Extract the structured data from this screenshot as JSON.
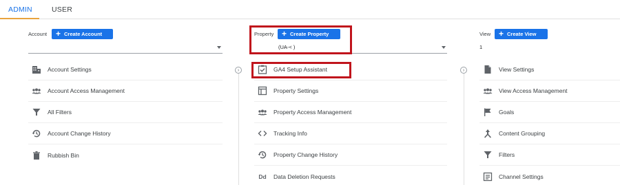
{
  "tabs": [
    {
      "label": "ADMIN",
      "active": true
    },
    {
      "label": "USER",
      "active": false
    }
  ],
  "account": {
    "label": "Account",
    "create_label": "Create Account",
    "selected": "",
    "items": [
      {
        "label": "Account Settings",
        "icon": "building-icon"
      },
      {
        "label": "Account Access Management",
        "icon": "people-icon"
      },
      {
        "label": "All Filters",
        "icon": "filter-icon"
      },
      {
        "label": "Account Change History",
        "icon": "history-icon"
      },
      {
        "label": "Rubbish Bin",
        "icon": "trash-icon"
      }
    ]
  },
  "property": {
    "label": "Property",
    "create_label": "Create Property",
    "selected": "(UA-<                )",
    "items": [
      {
        "label": "GA4 Setup Assistant",
        "icon": "checklist-icon"
      },
      {
        "label": "Property Settings",
        "icon": "window-icon"
      },
      {
        "label": "Property Access Management",
        "icon": "people-icon"
      },
      {
        "label": "Tracking Info",
        "icon": "code-icon"
      },
      {
        "label": "Property Change History",
        "icon": "history-icon"
      },
      {
        "label": "Data Deletion Requests",
        "icon": "dd-icon",
        "icon_text": "Dd"
      }
    ]
  },
  "view": {
    "label": "View",
    "create_label": "Create View",
    "selected": "1",
    "items": [
      {
        "label": "View Settings",
        "icon": "document-icon"
      },
      {
        "label": "View Access Management",
        "icon": "people-icon"
      },
      {
        "label": "Goals",
        "icon": "flag-icon"
      },
      {
        "label": "Content Grouping",
        "icon": "grouping-icon"
      },
      {
        "label": "Filters",
        "icon": "filter-icon"
      },
      {
        "label": "Channel Settings",
        "icon": "channel-icon"
      }
    ]
  },
  "colors": {
    "accent": "#1a73e8",
    "tab_underline": "#e8a33d",
    "highlight": "#c0141c",
    "icon": "#5f6368"
  }
}
